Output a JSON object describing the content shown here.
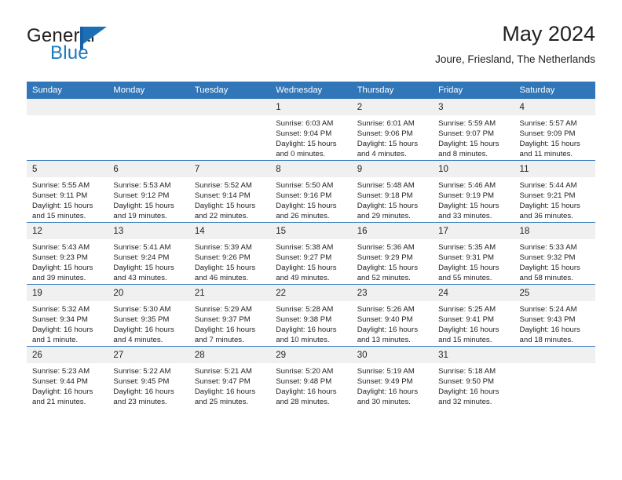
{
  "brand": {
    "name_top": "General",
    "name_bottom": "Blue",
    "flag_icon": "blue-flag-logo",
    "accent_color": "#1b7ac1"
  },
  "header": {
    "title": "May 2024",
    "subtitle": "Joure, Friesland, The Netherlands"
  },
  "colors": {
    "header_blue": "#3176b8",
    "daynum_band": "#f0f0f0",
    "text": "#231f20"
  },
  "weekday_headers": [
    "Sunday",
    "Monday",
    "Tuesday",
    "Wednesday",
    "Thursday",
    "Friday",
    "Saturday"
  ],
  "weeks": [
    [
      {
        "day": "",
        "lines": []
      },
      {
        "day": "",
        "lines": []
      },
      {
        "day": "",
        "lines": []
      },
      {
        "day": "1",
        "lines": [
          "Sunrise: 6:03 AM",
          "Sunset: 9:04 PM",
          "Daylight: 15 hours",
          "and 0 minutes."
        ]
      },
      {
        "day": "2",
        "lines": [
          "Sunrise: 6:01 AM",
          "Sunset: 9:06 PM",
          "Daylight: 15 hours",
          "and 4 minutes."
        ]
      },
      {
        "day": "3",
        "lines": [
          "Sunrise: 5:59 AM",
          "Sunset: 9:07 PM",
          "Daylight: 15 hours",
          "and 8 minutes."
        ]
      },
      {
        "day": "4",
        "lines": [
          "Sunrise: 5:57 AM",
          "Sunset: 9:09 PM",
          "Daylight: 15 hours",
          "and 11 minutes."
        ]
      }
    ],
    [
      {
        "day": "5",
        "lines": [
          "Sunrise: 5:55 AM",
          "Sunset: 9:11 PM",
          "Daylight: 15 hours",
          "and 15 minutes."
        ]
      },
      {
        "day": "6",
        "lines": [
          "Sunrise: 5:53 AM",
          "Sunset: 9:12 PM",
          "Daylight: 15 hours",
          "and 19 minutes."
        ]
      },
      {
        "day": "7",
        "lines": [
          "Sunrise: 5:52 AM",
          "Sunset: 9:14 PM",
          "Daylight: 15 hours",
          "and 22 minutes."
        ]
      },
      {
        "day": "8",
        "lines": [
          "Sunrise: 5:50 AM",
          "Sunset: 9:16 PM",
          "Daylight: 15 hours",
          "and 26 minutes."
        ]
      },
      {
        "day": "9",
        "lines": [
          "Sunrise: 5:48 AM",
          "Sunset: 9:18 PM",
          "Daylight: 15 hours",
          "and 29 minutes."
        ]
      },
      {
        "day": "10",
        "lines": [
          "Sunrise: 5:46 AM",
          "Sunset: 9:19 PM",
          "Daylight: 15 hours",
          "and 33 minutes."
        ]
      },
      {
        "day": "11",
        "lines": [
          "Sunrise: 5:44 AM",
          "Sunset: 9:21 PM",
          "Daylight: 15 hours",
          "and 36 minutes."
        ]
      }
    ],
    [
      {
        "day": "12",
        "lines": [
          "Sunrise: 5:43 AM",
          "Sunset: 9:23 PM",
          "Daylight: 15 hours",
          "and 39 minutes."
        ]
      },
      {
        "day": "13",
        "lines": [
          "Sunrise: 5:41 AM",
          "Sunset: 9:24 PM",
          "Daylight: 15 hours",
          "and 43 minutes."
        ]
      },
      {
        "day": "14",
        "lines": [
          "Sunrise: 5:39 AM",
          "Sunset: 9:26 PM",
          "Daylight: 15 hours",
          "and 46 minutes."
        ]
      },
      {
        "day": "15",
        "lines": [
          "Sunrise: 5:38 AM",
          "Sunset: 9:27 PM",
          "Daylight: 15 hours",
          "and 49 minutes."
        ]
      },
      {
        "day": "16",
        "lines": [
          "Sunrise: 5:36 AM",
          "Sunset: 9:29 PM",
          "Daylight: 15 hours",
          "and 52 minutes."
        ]
      },
      {
        "day": "17",
        "lines": [
          "Sunrise: 5:35 AM",
          "Sunset: 9:31 PM",
          "Daylight: 15 hours",
          "and 55 minutes."
        ]
      },
      {
        "day": "18",
        "lines": [
          "Sunrise: 5:33 AM",
          "Sunset: 9:32 PM",
          "Daylight: 15 hours",
          "and 58 minutes."
        ]
      }
    ],
    [
      {
        "day": "19",
        "lines": [
          "Sunrise: 5:32 AM",
          "Sunset: 9:34 PM",
          "Daylight: 16 hours",
          "and 1 minute."
        ]
      },
      {
        "day": "20",
        "lines": [
          "Sunrise: 5:30 AM",
          "Sunset: 9:35 PM",
          "Daylight: 16 hours",
          "and 4 minutes."
        ]
      },
      {
        "day": "21",
        "lines": [
          "Sunrise: 5:29 AM",
          "Sunset: 9:37 PM",
          "Daylight: 16 hours",
          "and 7 minutes."
        ]
      },
      {
        "day": "22",
        "lines": [
          "Sunrise: 5:28 AM",
          "Sunset: 9:38 PM",
          "Daylight: 16 hours",
          "and 10 minutes."
        ]
      },
      {
        "day": "23",
        "lines": [
          "Sunrise: 5:26 AM",
          "Sunset: 9:40 PM",
          "Daylight: 16 hours",
          "and 13 minutes."
        ]
      },
      {
        "day": "24",
        "lines": [
          "Sunrise: 5:25 AM",
          "Sunset: 9:41 PM",
          "Daylight: 16 hours",
          "and 15 minutes."
        ]
      },
      {
        "day": "25",
        "lines": [
          "Sunrise: 5:24 AM",
          "Sunset: 9:43 PM",
          "Daylight: 16 hours",
          "and 18 minutes."
        ]
      }
    ],
    [
      {
        "day": "26",
        "lines": [
          "Sunrise: 5:23 AM",
          "Sunset: 9:44 PM",
          "Daylight: 16 hours",
          "and 21 minutes."
        ]
      },
      {
        "day": "27",
        "lines": [
          "Sunrise: 5:22 AM",
          "Sunset: 9:45 PM",
          "Daylight: 16 hours",
          "and 23 minutes."
        ]
      },
      {
        "day": "28",
        "lines": [
          "Sunrise: 5:21 AM",
          "Sunset: 9:47 PM",
          "Daylight: 16 hours",
          "and 25 minutes."
        ]
      },
      {
        "day": "29",
        "lines": [
          "Sunrise: 5:20 AM",
          "Sunset: 9:48 PM",
          "Daylight: 16 hours",
          "and 28 minutes."
        ]
      },
      {
        "day": "30",
        "lines": [
          "Sunrise: 5:19 AM",
          "Sunset: 9:49 PM",
          "Daylight: 16 hours",
          "and 30 minutes."
        ]
      },
      {
        "day": "31",
        "lines": [
          "Sunrise: 5:18 AM",
          "Sunset: 9:50 PM",
          "Daylight: 16 hours",
          "and 32 minutes."
        ]
      },
      {
        "day": "",
        "lines": []
      }
    ]
  ]
}
